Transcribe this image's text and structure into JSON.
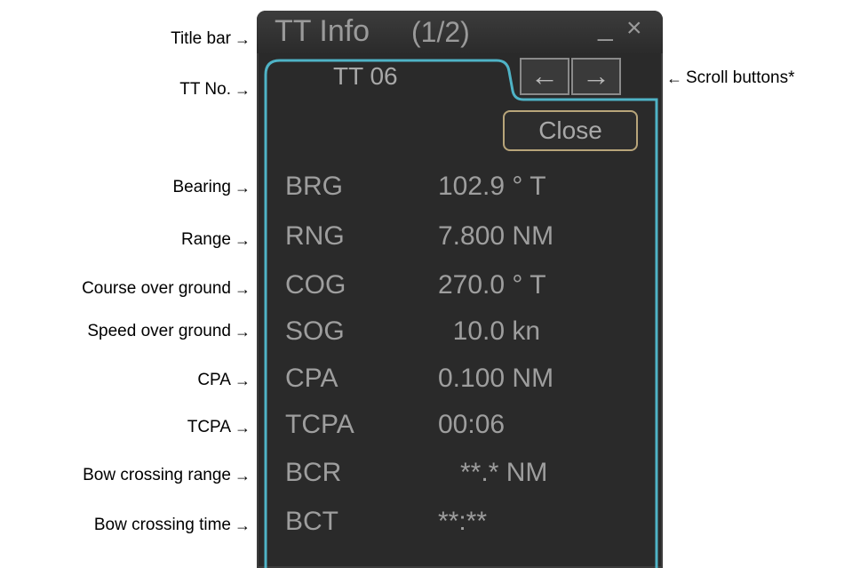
{
  "annotations": {
    "title_bar": "Title bar",
    "tt_no": "TT No.",
    "bearing": "Bearing",
    "range": "Range",
    "cog": "Course over ground",
    "sog": "Speed over ground",
    "cpa": "CPA",
    "tcpa": "TCPA",
    "bcr": "Bow crossing range",
    "bct": "Bow crossing time",
    "scroll_buttons": "Scroll buttons*"
  },
  "window": {
    "title": "TT Info",
    "page": "(1/2)",
    "minimize": "_",
    "close": "×"
  },
  "tab": {
    "label": "TT 06"
  },
  "scroll": {
    "left": "←",
    "right": "→"
  },
  "close_button": "Close",
  "rows": [
    {
      "label": "BRG",
      "value": "102.9 ° T"
    },
    {
      "label": "RNG",
      "value": "7.800 NM"
    },
    {
      "label": "COG",
      "value": "270.0 ° T"
    },
    {
      "label": "SOG",
      "value": "  10.0 kn"
    },
    {
      "label": "CPA",
      "value": "0.100 NM"
    },
    {
      "label": "TCPA",
      "value": "00:06"
    },
    {
      "label": "BCR",
      "value": "   **.* NM"
    },
    {
      "label": "BCT",
      "value": "**:**"
    }
  ],
  "colors": {
    "panel_bg": "#2a2a2a",
    "tab_border": "#4fb3c6",
    "close_border": "#b8a57a",
    "text": "#9e9e9e"
  }
}
